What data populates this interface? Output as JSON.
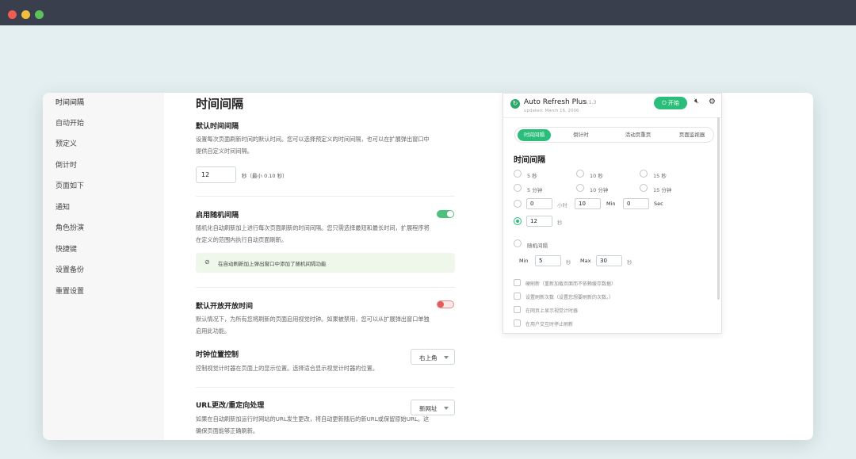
{
  "sidebar": {
    "items": [
      {
        "label": "时间间隔"
      },
      {
        "label": "自动开始"
      },
      {
        "label": "预定义"
      },
      {
        "label": "倒计时"
      },
      {
        "label": "页面如下"
      },
      {
        "label": "通知"
      },
      {
        "label": "角色扮演"
      },
      {
        "label": "快捷键"
      },
      {
        "label": "设置备份"
      },
      {
        "label": "重置设置"
      }
    ]
  },
  "main": {
    "title": "时间间隔",
    "default_interval": {
      "title": "默认时间间隔",
      "desc": "设置每次页面刷新时间的默认时间。您可以选择预定义的时间间隔，也可以在扩展弹出窗口中提供自定义时间间隔。",
      "value": "12",
      "unit": "秒（最小 0.10 秒）"
    },
    "random_interval": {
      "title": "启用随机间隔",
      "desc": "随机化自动刷新加上进行每次页面刷新的时间间隔。您只需选择最短和最长时间，扩展程序将在定义的范围内执行自动页面刷新。",
      "enabled": true,
      "banner": "在自动刷新加上弹出窗口中添加了随机间隔功能"
    },
    "default_open": {
      "title": "默认开放开放时间",
      "desc": "默认情况下，为所有您将刷新的页面启用视觉时钟。如果被禁用，您可以从扩展弹出窗口单独启用此功能。",
      "enabled": false
    },
    "clock_position": {
      "title": "时钟位置控制",
      "desc": "控制视觉计时器在页面上的显示位置。选择适合显示视觉计时器的位置。",
      "selected": "右上角"
    },
    "url_change": {
      "title": "URL更改/重定向处理",
      "desc": "如果在自动刷新加运行时网站的URL发生更改，将自动更新随后的新URL或保留原始URL。这确保页面能够正确刷新。",
      "selected": "新网址"
    }
  },
  "popup": {
    "app_name": "Auto Refresh Plus",
    "version": "8.1.3",
    "updated": "updated: March 16, 2006",
    "start_label": "开始",
    "tabs": [
      {
        "label": "时间间隔",
        "active": true
      },
      {
        "label": "倒计时",
        "active": false
      },
      {
        "label": "活动页重页",
        "active": false
      },
      {
        "label": "页面监视器",
        "active": false
      }
    ],
    "section_title": "时间间隔",
    "presets": [
      {
        "label": "5 秒"
      },
      {
        "label": "10 秒"
      },
      {
        "label": "15 秒"
      },
      {
        "label": "5 分钟"
      },
      {
        "label": "10 分钟"
      },
      {
        "label": "15 分钟"
      }
    ],
    "custom": {
      "hours": "0",
      "hours_unit": "小时",
      "minutes": "10",
      "minutes_unit": "Min",
      "seconds": "0",
      "seconds_unit": "Sec"
    },
    "seconds_value": "12",
    "seconds_value_unit": "秒",
    "random_label": "随机间隔",
    "min_label": "Min",
    "min_value": "5",
    "min_unit": "秒",
    "max_label": "Max",
    "max_value": "30",
    "max_unit": "秒",
    "checkboxes": [
      {
        "label": "硬刷新（重新加载页面而不依赖缓存数据）"
      },
      {
        "label": "设置刷新次数（设置您想要刷新的次数。）"
      },
      {
        "label": "在网页上显示视觉计时器"
      },
      {
        "label": "在用户交互时停止刷新"
      }
    ],
    "accent_color": "#2bbd7a"
  }
}
